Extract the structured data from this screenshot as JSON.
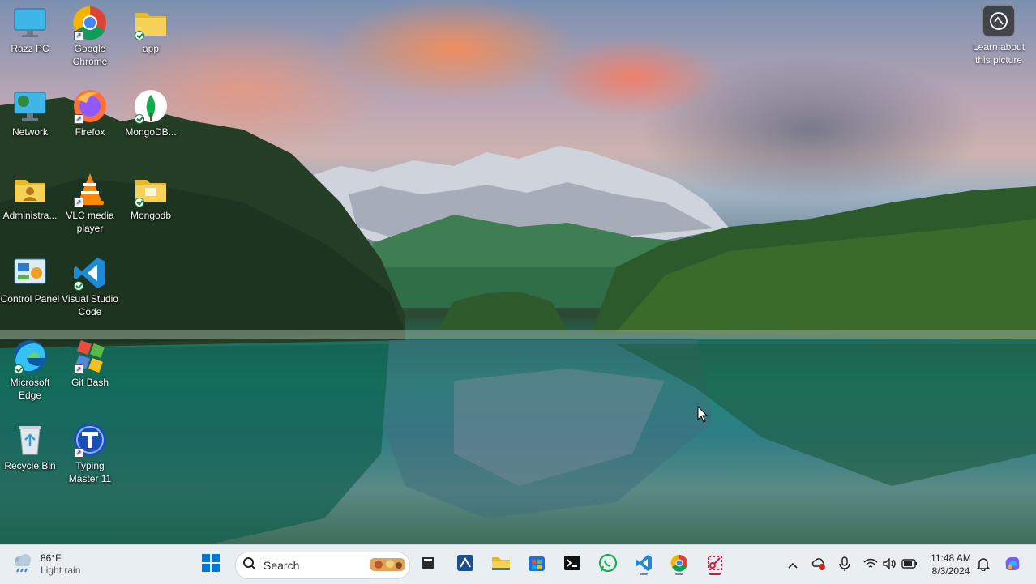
{
  "desktop": {
    "icons": [
      {
        "label": "Razz PC",
        "icon": "monitor-icon"
      },
      {
        "label": "Google Chrome",
        "icon": "chrome-icon"
      },
      {
        "label": "app",
        "icon": "folder-icon"
      },
      {
        "label": "Network",
        "icon": "network-icon"
      },
      {
        "label": "Firefox",
        "icon": "firefox-icon"
      },
      {
        "label": "MongoDB...",
        "icon": "mongodb-icon"
      },
      {
        "label": "Administra...",
        "icon": "user-folder-icon"
      },
      {
        "label": "VLC media player",
        "icon": "vlc-icon"
      },
      {
        "label": "Mongodb",
        "icon": "folder-icon"
      },
      {
        "label": "Control Panel",
        "icon": "control-panel-icon"
      },
      {
        "label": "Visual Studio Code",
        "icon": "vscode-icon"
      },
      {
        "label": "Microsoft Edge",
        "icon": "edge-icon"
      },
      {
        "label": "Git Bash",
        "icon": "git-bash-icon"
      },
      {
        "label": "Recycle Bin",
        "icon": "recycle-bin-icon"
      },
      {
        "label": "Typing Master 11",
        "icon": "typing-master-icon"
      }
    ],
    "learn_about": "Learn about this picture"
  },
  "taskbar": {
    "weather": {
      "temp": "86°F",
      "condition": "Light rain"
    },
    "search_label": "Search",
    "apps": [
      "start-icon",
      "file-icon",
      "snipping-icon",
      "explorer-icon",
      "store-icon",
      "terminal-icon",
      "whatsapp-icon",
      "vscode-icon",
      "chrome-icon",
      "snip-tool-icon"
    ],
    "clock": {
      "time": "11:48 AM",
      "date": "8/3/2024"
    }
  },
  "colors": {
    "accent": "#0078d4",
    "taskbar_bg": "#e9eef2"
  }
}
